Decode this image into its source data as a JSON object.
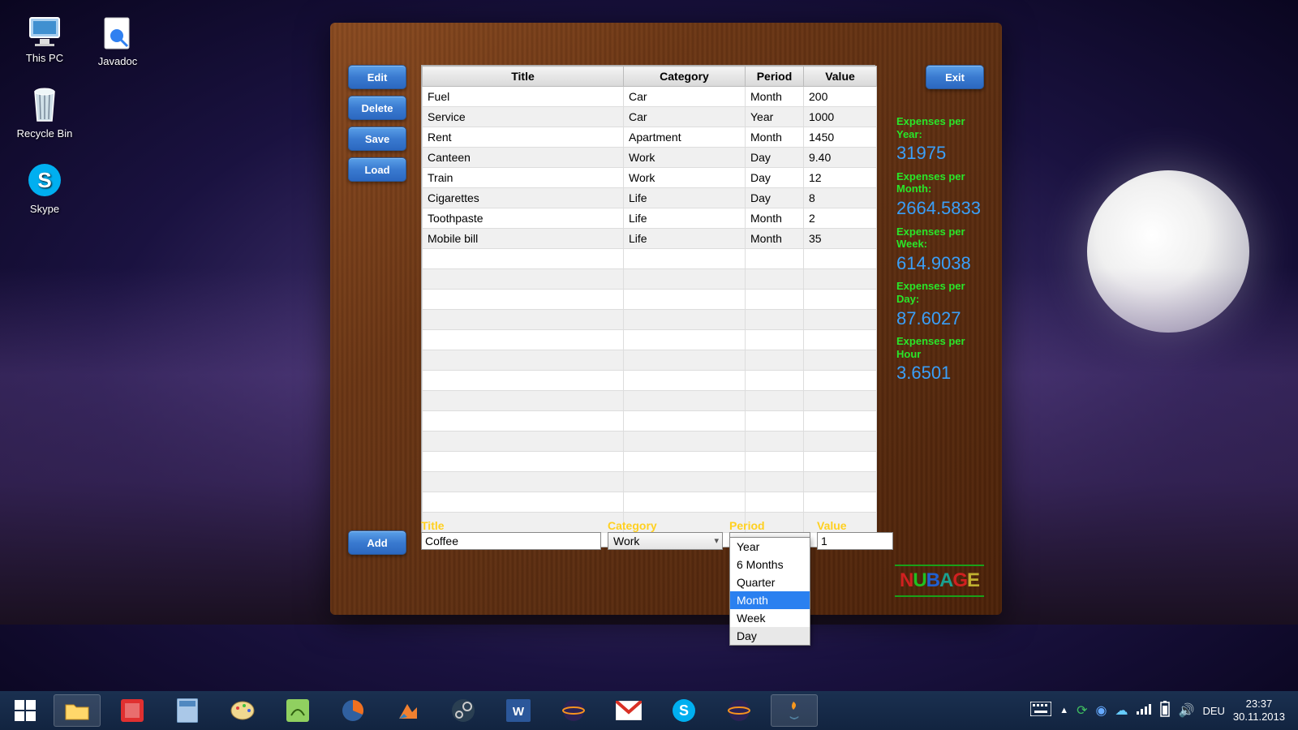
{
  "desktop": {
    "icons": [
      {
        "name": "this-pc",
        "label": "This PC"
      },
      {
        "name": "recycle-bin",
        "label": "Recycle Bin"
      },
      {
        "name": "skype",
        "label": "Skype"
      },
      {
        "name": "javadoc",
        "label": "Javadoc"
      }
    ]
  },
  "app": {
    "buttons": {
      "edit": "Edit",
      "delete": "Delete",
      "save": "Save",
      "load": "Load",
      "add": "Add",
      "exit": "Exit"
    },
    "table": {
      "headers": {
        "title": "Title",
        "category": "Category",
        "period": "Period",
        "value": "Value"
      },
      "rows": [
        {
          "title": "Fuel",
          "category": "Car",
          "period": "Month",
          "value": "200"
        },
        {
          "title": "Service",
          "category": "Car",
          "period": "Year",
          "value": "1000"
        },
        {
          "title": "Rent",
          "category": "Apartment",
          "period": "Month",
          "value": "1450"
        },
        {
          "title": "Canteen",
          "category": "Work",
          "period": "Day",
          "value": "9.40"
        },
        {
          "title": "Train",
          "category": "Work",
          "period": "Day",
          "value": "12"
        },
        {
          "title": "Cigarettes",
          "category": "Life",
          "period": "Day",
          "value": "8"
        },
        {
          "title": "Toothpaste",
          "category": "Life",
          "period": "Month",
          "value": "2"
        },
        {
          "title": "Mobile bill",
          "category": "Life",
          "period": "Month",
          "value": "35"
        }
      ]
    },
    "stats": {
      "year": {
        "label": "Expenses per Year:",
        "value": "31975"
      },
      "month": {
        "label": "Expenses per Month:",
        "value": "2664.5833"
      },
      "week": {
        "label": "Expenses per Week:",
        "value": "614.9038"
      },
      "day": {
        "label": "Expenses per Day:",
        "value": "87.6027"
      },
      "hour": {
        "label": "Expenses per Hour",
        "value": "3.6501"
      }
    },
    "form": {
      "labels": {
        "title": "Title",
        "category": "Category",
        "period": "Period",
        "value": "Value"
      },
      "title_value": "Coffee",
      "category_value": "Work",
      "value_value": "1",
      "period_options": [
        "Year",
        "6 Months",
        "Quarter",
        "Month",
        "Week",
        "Day"
      ],
      "period_highlight": "Month"
    },
    "logo": "NUBAGE"
  },
  "taskbar": {
    "tray": {
      "lang": "DEU",
      "time": "23:37",
      "date": "30.11.2013"
    }
  }
}
